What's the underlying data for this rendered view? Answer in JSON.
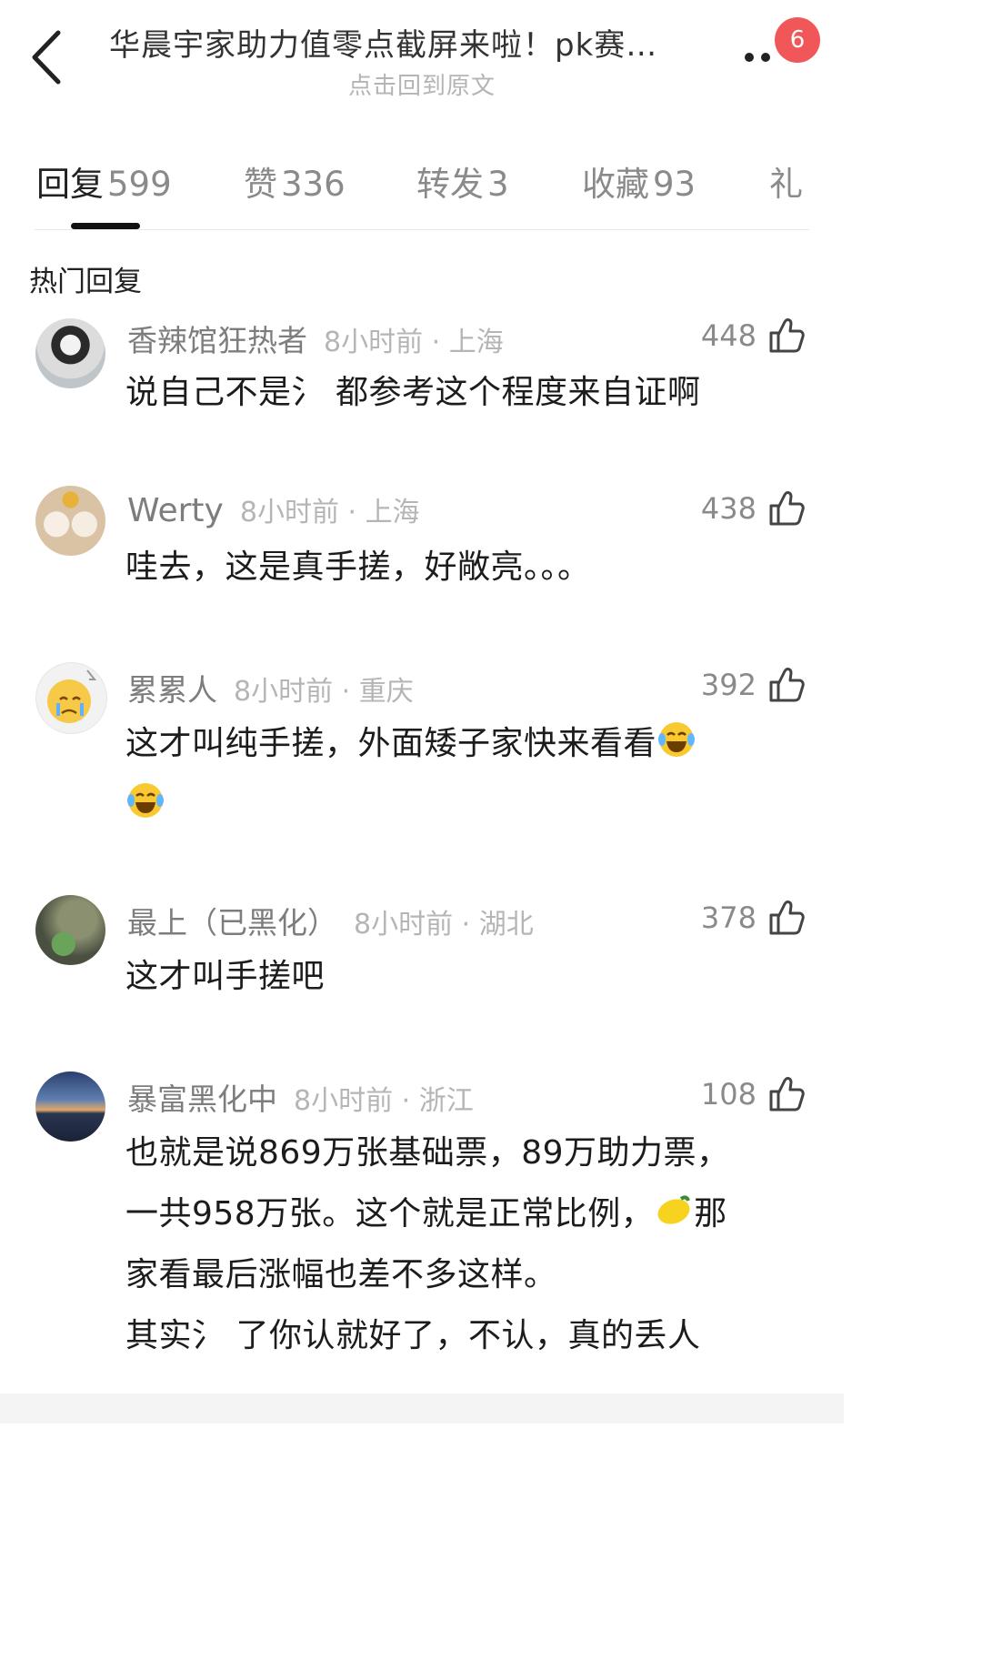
{
  "header": {
    "title": "华晨宇家助力值零点截屏来啦！pk赛…",
    "subtitle": "点击回到原文",
    "notification_count": "6",
    "back_icon": "chevron-left-icon",
    "more_icon": "more-dots-icon"
  },
  "tabs": [
    {
      "label": "回复",
      "count": "599"
    },
    {
      "label": "赞",
      "count": "336"
    },
    {
      "label": "转发",
      "count": "3"
    },
    {
      "label": "收藏",
      "count": "93"
    },
    {
      "label": "礼",
      "count": ""
    }
  ],
  "section_title": "热门回复",
  "comments": [
    {
      "username": "香辣馆狂热者",
      "time": "8小时前",
      "location": "上海",
      "likes": "448",
      "text": "说自己不是氵 都参考这个程度来自证啊"
    },
    {
      "username": "Werty",
      "time": "8小时前",
      "location": "上海",
      "likes": "438",
      "text": "哇去，这是真手搓，好敞亮。。。"
    },
    {
      "username": "累累人",
      "time": "8小时前",
      "location": "重庆",
      "likes": "392",
      "text": "这才叫纯手搓，外面矮子家快来看看"
    },
    {
      "username": "最上（已黑化）",
      "time": "8小时前",
      "location": "湖北",
      "likes": "378",
      "text": "这才叫手搓吧"
    },
    {
      "username": "暴富黑化中",
      "time": "8小时前",
      "location": "浙江",
      "likes": "108",
      "text_lines": [
        "也就是说869万张基础票，89万助力票，",
        "一共958万张。这个就是正常比例，",
        "那",
        "家看最后涨幅也差不多这样。",
        "其实氵 了你认就好了，不认，真的丢人"
      ]
    }
  ],
  "colors": {
    "badge": "#f15758",
    "accent": "#111111"
  }
}
